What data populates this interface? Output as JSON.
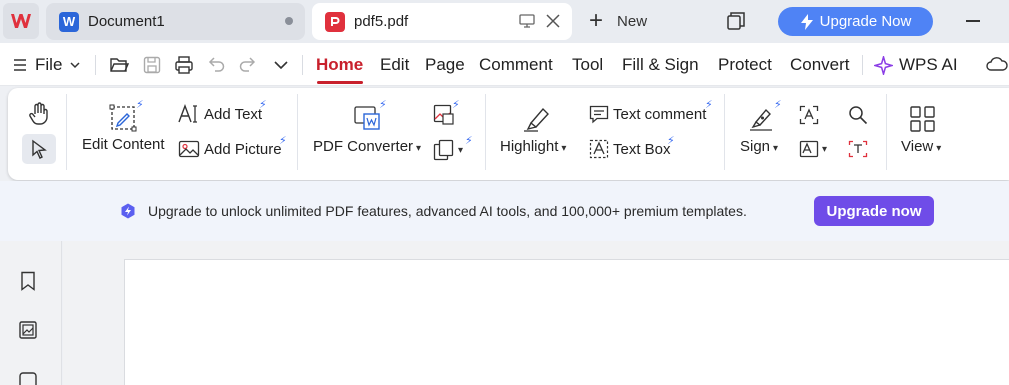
{
  "tabs": {
    "doc": {
      "title": "Document1"
    },
    "pdf": {
      "title": "pdf5.pdf"
    },
    "new_label": "New"
  },
  "upgrade_top": {
    "label": "Upgrade Now"
  },
  "menu": {
    "file": "File",
    "items": [
      "Home",
      "Edit",
      "Page",
      "Comment",
      "Tool",
      "Fill & Sign",
      "Protect",
      "Convert"
    ],
    "ai": "WPS AI"
  },
  "ribbon": {
    "edit_content": "Edit Content",
    "add_text": "Add Text",
    "add_picture": "Add Picture",
    "pdf_converter": "PDF Converter",
    "highlight": "Highlight",
    "text_comment": "Text comment",
    "text_box": "Text Box",
    "sign": "Sign",
    "view": "View"
  },
  "banner": {
    "text": "Upgrade to unlock unlimited PDF features, advanced AI tools, and 100,000+ premium templates.",
    "button": "Upgrade now"
  },
  "colors": {
    "accent_red": "#c8202c",
    "upgrade_blue": "#4f83f5",
    "upgrade_purple": "#6f4ce8",
    "word_blue": "#2b66d9",
    "pdf_red": "#e0313d"
  },
  "icons": [
    "wps-logo-icon",
    "word-icon",
    "pdf-icon",
    "monitor-icon",
    "close-icon",
    "plus-icon",
    "restore-window-icon",
    "lightning-icon",
    "minimize-icon",
    "menu-icon",
    "folder-open-icon",
    "save-icon",
    "print-icon",
    "undo-icon",
    "redo-icon",
    "chevron-down-icon",
    "wps-ai-icon",
    "cloud-icon",
    "hand-icon",
    "select-cursor-icon",
    "edit-content-icon",
    "add-text-icon",
    "add-picture-icon",
    "pdf-converter-icon",
    "image-convert-icon",
    "copy-format-icon",
    "highlight-icon",
    "text-comment-icon",
    "text-box-icon",
    "sign-icon",
    "ocr-icon",
    "search-icon",
    "fill-form-icon",
    "redact-icon",
    "view-icon",
    "bookmark-icon",
    "thumbnail-icon"
  ]
}
